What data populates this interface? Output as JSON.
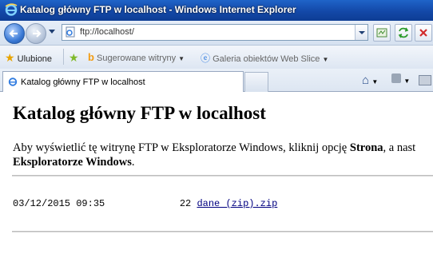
{
  "window": {
    "title": "Katalog główny FTP w localhost - Windows Internet Explorer"
  },
  "navigation": {
    "address": "ftp://localhost/",
    "icons": [
      "back-icon",
      "forward-icon",
      "page-icon",
      "compatibility-icon",
      "refresh-icon",
      "stop-icon"
    ]
  },
  "favorites_bar": {
    "favorites_label": "Ulubione",
    "suggested_sites": "Sugerowane witryny",
    "web_slice_gallery": "Galeria obiektów Web Slice"
  },
  "tabs": [
    {
      "label": "Katalog główny FTP w localhost"
    }
  ],
  "page": {
    "heading": "Katalog główny FTP w localhost",
    "info_prefix": "Aby wyświetlić tę witrynę FTP w Eksploratorze Windows, kliknij opcję ",
    "info_bold1": "Strona",
    "info_mid": ", a nast",
    "info_bold2": "Eksploratorze Windows",
    "info_end": "."
  },
  "listing": [
    {
      "date": "03/12/2015 09:35",
      "size": "22",
      "name": "dane (zip).zip"
    }
  ],
  "colors": {
    "titlebar": "#1348a8",
    "link": "#000080"
  }
}
